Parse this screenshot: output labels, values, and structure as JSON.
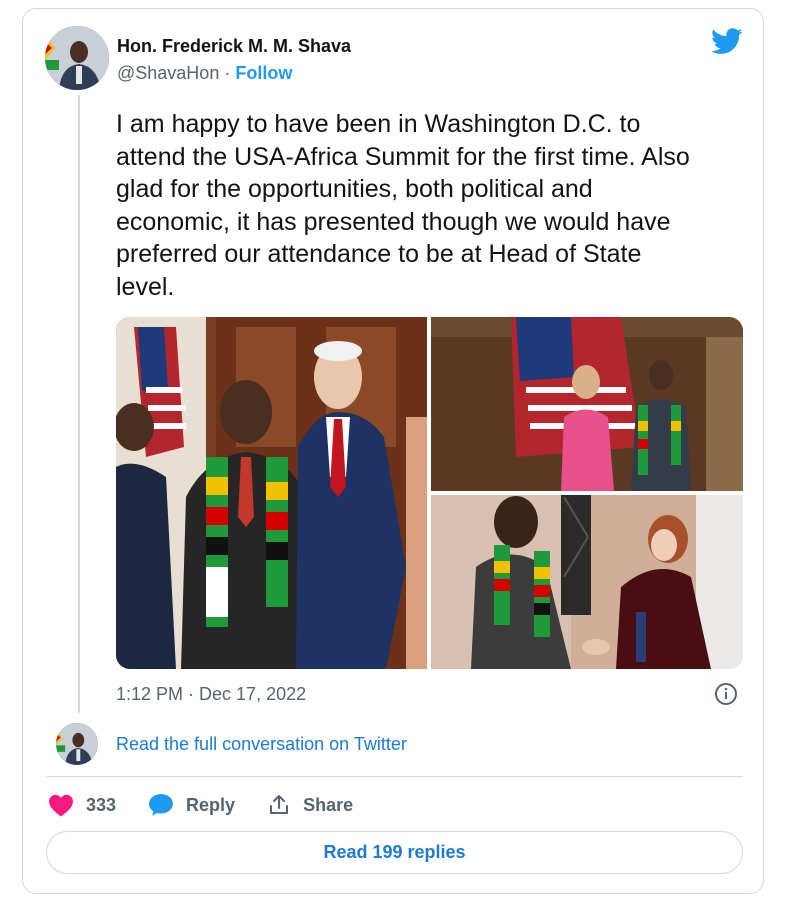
{
  "author": {
    "name": "Hon. Frederick M. M. Shava",
    "handle": "@ShavaHon",
    "separator": " · ",
    "follow_label": "Follow"
  },
  "tweet": {
    "text": "I am happy to have been in Washington D.C. to\nattend the USA-Africa Summit for the first time. Also\nglad for the opportunities, both political and\neconomic, it has presented though we would have\npreferred our attendance to be at Head of State\nlevel.",
    "timestamp": "1:12 PM · Dec 17, 2022"
  },
  "conversation_link": "Read the full conversation on Twitter",
  "actions": {
    "likes_count": "333",
    "reply_label": "Reply",
    "share_label": "Share"
  },
  "read_replies_label": "Read 199 replies",
  "icons": {
    "brand": "twitter-bird-icon",
    "info": "info-icon",
    "like": "heart-icon",
    "reply": "speech-bubble-icon",
    "share": "share-arrow-icon"
  },
  "colors": {
    "accent": "#1d9bf0",
    "link": "#1d7bd0",
    "like": "#f91880",
    "muted": "#536471",
    "border": "#cfd9de"
  }
}
